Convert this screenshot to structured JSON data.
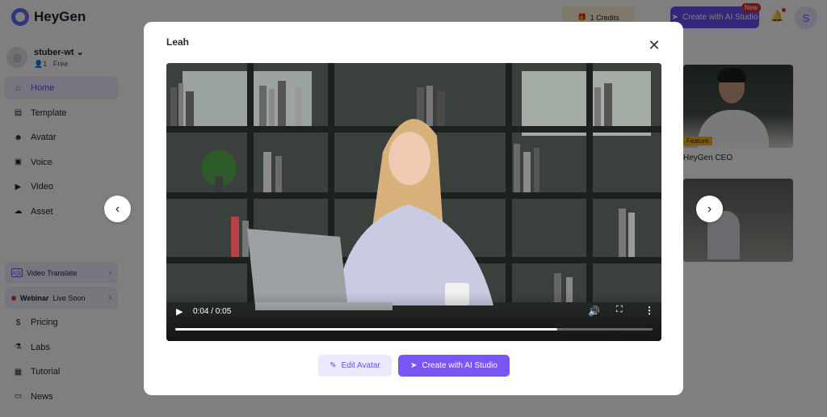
{
  "app": {
    "name": "HeyGen"
  },
  "workspace": {
    "name": "stuber-wt",
    "members": "1",
    "plan": "Free"
  },
  "sidebar": {
    "items": [
      {
        "label": "Home",
        "icon": "home-icon",
        "active": true
      },
      {
        "label": "Template",
        "icon": "template-icon"
      },
      {
        "label": "Avatar",
        "icon": "avatar-icon"
      },
      {
        "label": "Voice",
        "icon": "voice-icon"
      },
      {
        "label": "Video",
        "icon": "video-icon"
      },
      {
        "label": "Asset",
        "icon": "asset-icon"
      }
    ],
    "promos": [
      {
        "label": "Video Translate"
      },
      {
        "label_bold": "Webinar",
        "label_rest": "Live Soon"
      }
    ],
    "bottom_items": [
      {
        "label": "Pricing",
        "icon": "pricing-icon"
      },
      {
        "label": "Labs",
        "icon": "labs-icon"
      },
      {
        "label": "Tutorial",
        "icon": "tutorial-icon"
      },
      {
        "label": "News",
        "icon": "news-icon"
      }
    ]
  },
  "topbar": {
    "credits": "1 Credits",
    "create_label": "Create with AI Studio",
    "new_badge": "New",
    "user_initial": "S"
  },
  "background_cards": [
    {
      "tag": "Feature",
      "label": "HeyGen CEO"
    }
  ],
  "modal": {
    "title": "Leah",
    "video": {
      "time": "0:04 / 0:05",
      "progress": 0.8
    },
    "edit_label": "Edit Avatar",
    "create_label": "Create with AI Studio"
  },
  "colors": {
    "accent": "#6d4cf5",
    "accent_light": "#ece9fe",
    "overlay": "rgba(0,0,0,0.5)"
  }
}
